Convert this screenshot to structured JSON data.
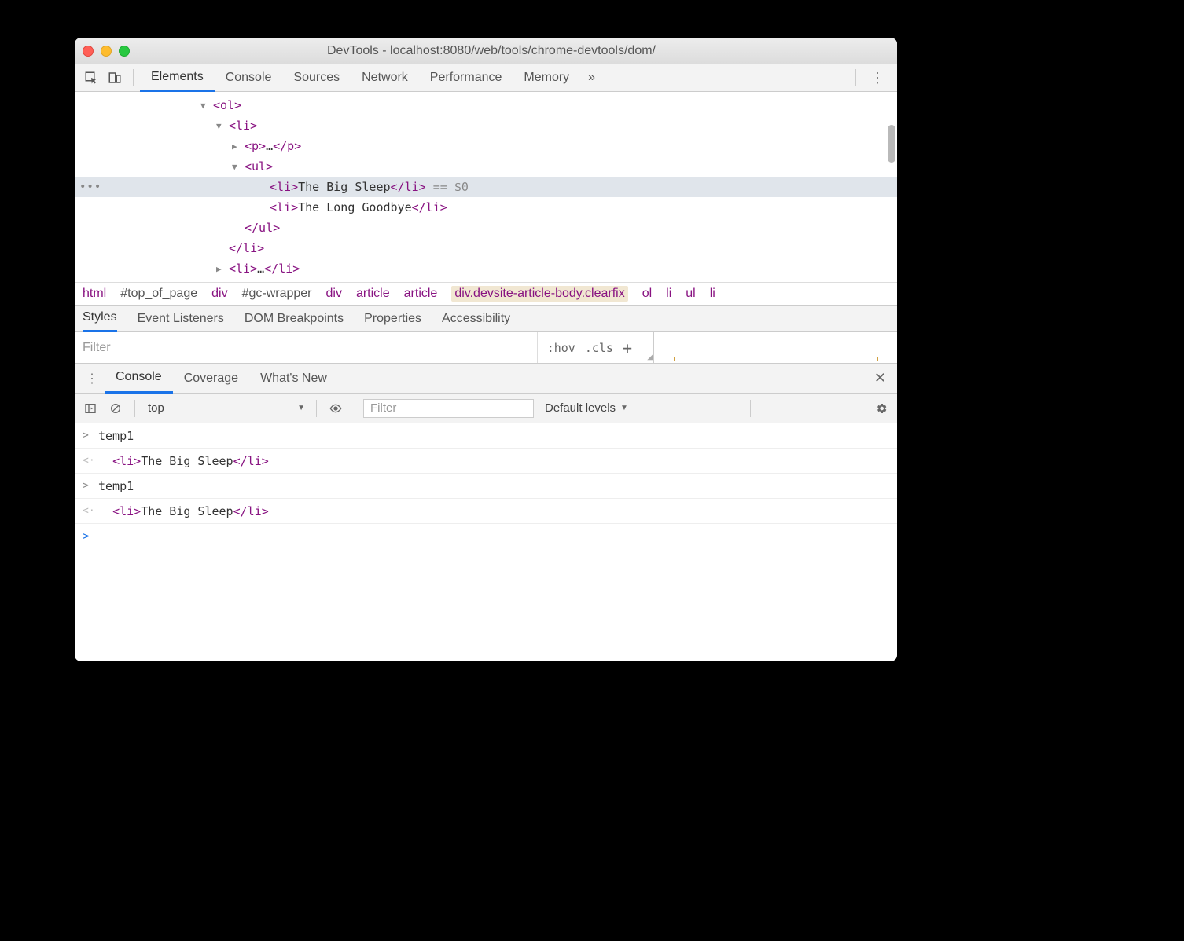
{
  "window": {
    "title": "DevTools - localhost:8080/web/tools/chrome-devtools/dom/"
  },
  "main_tabs": {
    "items": [
      "Elements",
      "Console",
      "Sources",
      "Network",
      "Performance",
      "Memory"
    ],
    "active": 0,
    "overflow": "»"
  },
  "dom": {
    "lines": [
      {
        "indent": "indent1",
        "arrow": "▼",
        "html": "<ol>",
        "sel": false
      },
      {
        "indent": "indent2",
        "arrow": "▼",
        "html": "<li>",
        "sel": false
      },
      {
        "indent": "indent3",
        "arrow": "▶",
        "html": "<p>…</p>",
        "sel": false
      },
      {
        "indent": "indent3",
        "arrow": "▼",
        "html": "<ul>",
        "sel": false
      },
      {
        "indent": "indent4",
        "arrow": "",
        "html": "<li>The Big Sleep</li>",
        "suffix": " == $0",
        "sel": true,
        "dots": true
      },
      {
        "indent": "indent4",
        "arrow": "",
        "html": "<li>The Long Goodbye</li>",
        "sel": false
      },
      {
        "indent": "indent3",
        "arrow": "",
        "html": "</ul>",
        "sel": false
      },
      {
        "indent": "indent2",
        "arrow": "",
        "html": "</li>",
        "sel": false
      },
      {
        "indent": "indent2",
        "arrow": "▶",
        "html": "<li>…</li>",
        "sel": false
      }
    ]
  },
  "breadcrumb": {
    "items": [
      {
        "t": "html",
        "cls": "bc"
      },
      {
        "t": "#top_of_page",
        "cls": "bc sel"
      },
      {
        "t": "div",
        "cls": "bc"
      },
      {
        "t": "#gc-wrapper",
        "cls": "bc sel"
      },
      {
        "t": "div",
        "cls": "bc"
      },
      {
        "t": "article",
        "cls": "bc"
      },
      {
        "t": "article",
        "cls": "bc"
      },
      {
        "t": "div.devsite-article-body.clearfix",
        "cls": "bc hl"
      },
      {
        "t": "ol",
        "cls": "bc"
      },
      {
        "t": "li",
        "cls": "bc"
      },
      {
        "t": "ul",
        "cls": "bc"
      },
      {
        "t": "li",
        "cls": "bc"
      }
    ]
  },
  "subtabs": {
    "items": [
      "Styles",
      "Event Listeners",
      "DOM Breakpoints",
      "Properties",
      "Accessibility"
    ],
    "active": 0
  },
  "filter": {
    "placeholder": "Filter",
    "hov": ":hov",
    "cls": ".cls",
    "plus": "+"
  },
  "drawer": {
    "tabs": [
      "Console",
      "Coverage",
      "What's New"
    ],
    "active": 0
  },
  "console_toolbar": {
    "context": "top",
    "filter_placeholder": "Filter",
    "levels": "Default levels"
  },
  "console": {
    "rows": [
      {
        "kind": "in",
        "text": "temp1"
      },
      {
        "kind": "out",
        "tag_open": "<li>",
        "text": "The Big Sleep",
        "tag_close": "</li>"
      },
      {
        "kind": "in",
        "text": "temp1"
      },
      {
        "kind": "out",
        "tag_open": "<li>",
        "text": "The Big Sleep",
        "tag_close": "</li>"
      },
      {
        "kind": "prompt"
      }
    ]
  }
}
